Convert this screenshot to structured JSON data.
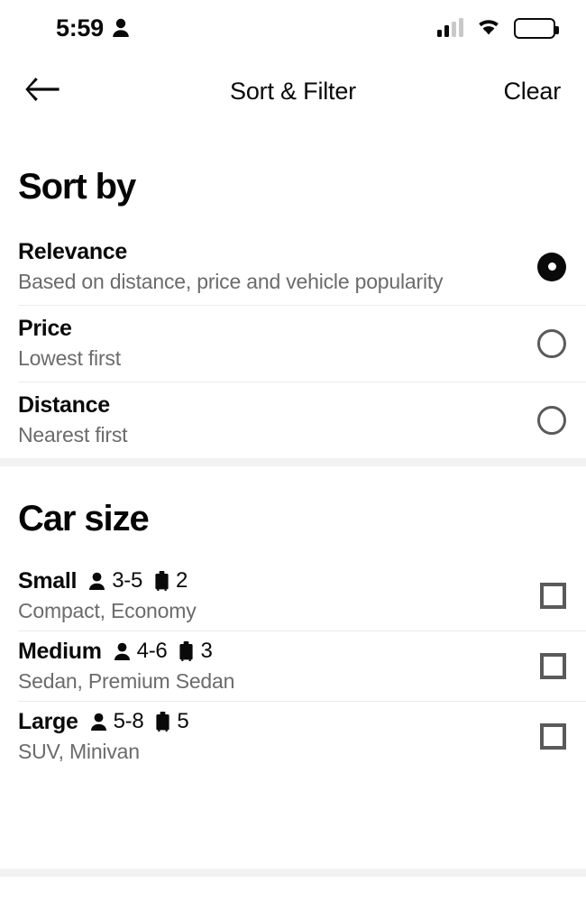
{
  "status_bar": {
    "time": "5:59",
    "person_icon": "person-icon",
    "signal_icon": "signal-bars-icon",
    "wifi_icon": "wifi-icon",
    "battery_icon": "battery-full-icon"
  },
  "header": {
    "back_icon": "back-arrow-icon",
    "title": "Sort & Filter",
    "clear_label": "Clear"
  },
  "sort_section": {
    "title": "Sort by",
    "options": [
      {
        "label": "Relevance",
        "sublabel": "Based on distance, price and vehicle popularity",
        "selected": true
      },
      {
        "label": "Price",
        "sublabel": "Lowest first",
        "selected": false
      },
      {
        "label": "Distance",
        "sublabel": "Nearest first",
        "selected": false
      }
    ]
  },
  "car_size_section": {
    "title": "Car size",
    "passenger_icon": "passenger-icon",
    "luggage_icon": "luggage-icon",
    "options": [
      {
        "label": "Small",
        "passengers": "3-5",
        "luggage": "2",
        "sublabel": "Compact, Economy",
        "checked": false
      },
      {
        "label": "Medium",
        "passengers": "4-6",
        "luggage": "3",
        "sublabel": "Sedan, Premium Sedan",
        "checked": false
      },
      {
        "label": "Large",
        "passengers": "5-8",
        "luggage": "5",
        "sublabel": "SUV, Minivan",
        "checked": false
      }
    ]
  },
  "colors": {
    "text_primary": "#0a0a0a",
    "text_secondary": "#6b6b6b",
    "divider": "#ececec",
    "section_gap": "#f2f2f2",
    "control_outline": "#5a5a5a",
    "background": "#ffffff"
  }
}
